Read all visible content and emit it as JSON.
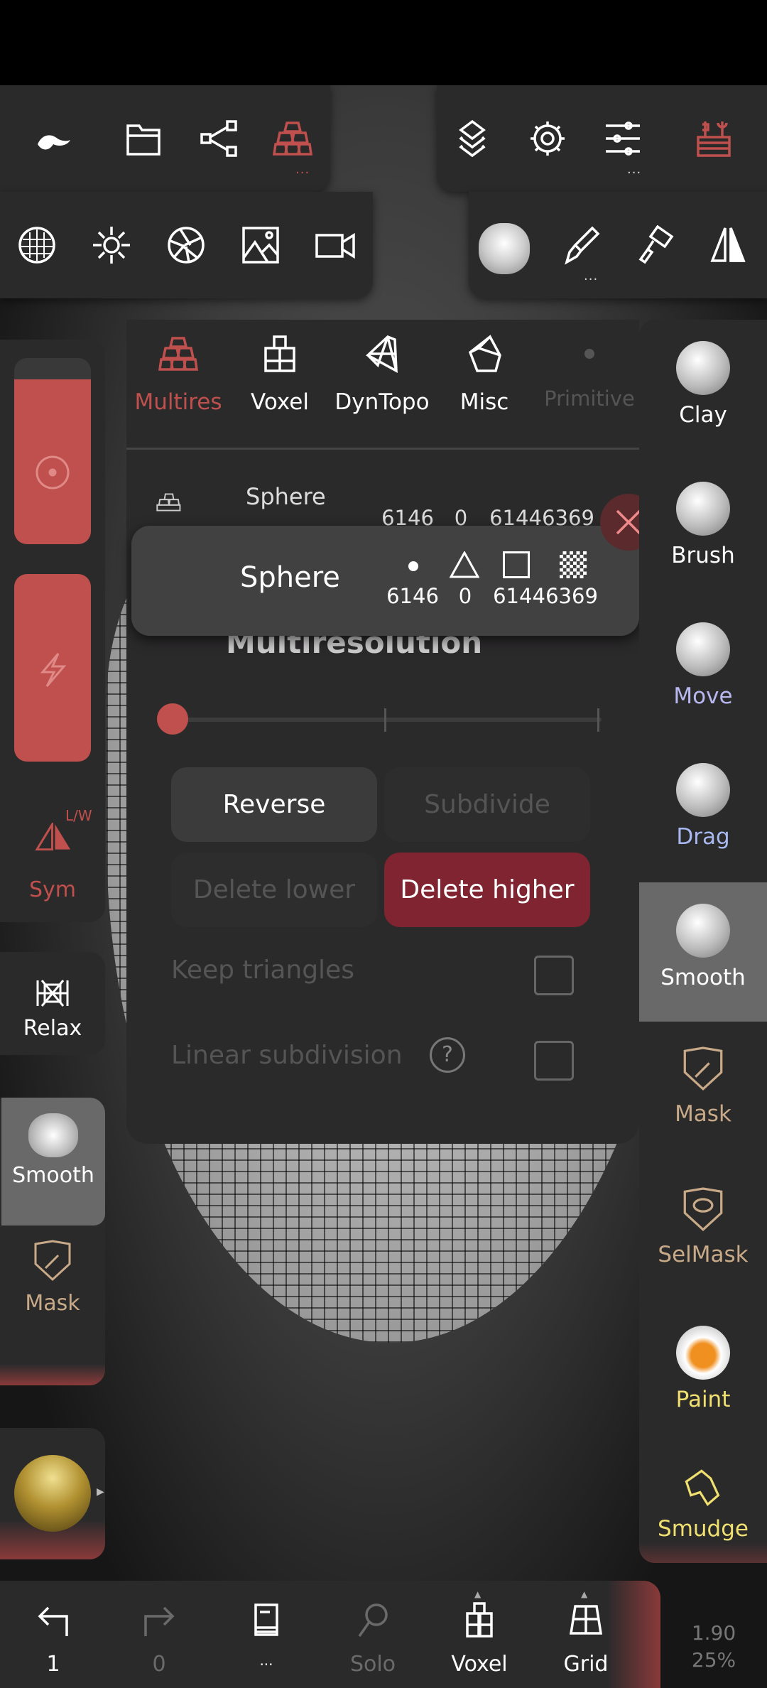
{
  "colors": {
    "accent": "#c0504d",
    "danger": "#7f2430",
    "panel": "#2b2a2b"
  },
  "top_toolbar": {
    "left": [
      {
        "icon": "nomad-logo-icon"
      },
      {
        "icon": "folder-icon"
      },
      {
        "icon": "share-icon"
      },
      {
        "icon": "multires-icon",
        "active": true,
        "more": "..."
      }
    ],
    "right": [
      {
        "icon": "layers-icon"
      },
      {
        "icon": "gear-icon"
      },
      {
        "icon": "sliders-icon",
        "more": "..."
      },
      {
        "icon": "toolbox-icon",
        "active": true
      }
    ]
  },
  "second_toolbar": {
    "left": [
      {
        "icon": "grid-sphere-icon"
      },
      {
        "icon": "sun-icon"
      },
      {
        "icon": "aperture-icon"
      },
      {
        "icon": "image-icon"
      },
      {
        "icon": "video-camera-icon"
      }
    ],
    "right": [
      {
        "icon": "smooth-brush-icon"
      },
      {
        "icon": "paint-brush-icon",
        "more": "..."
      },
      {
        "icon": "paint-roller-icon"
      },
      {
        "icon": "symmetry-icon"
      }
    ]
  },
  "panel": {
    "tabs": [
      {
        "label": "Multires",
        "active": true
      },
      {
        "label": "Voxel"
      },
      {
        "label": "DynTopo"
      },
      {
        "label": "Misc"
      },
      {
        "label": "Primitive",
        "disabled": true
      }
    ],
    "mesh_row": {
      "name": "Sphere",
      "vertices": "6146",
      "triangles": "0",
      "quads": "6144",
      "uvs": "6369"
    },
    "popup": {
      "name": "Sphere",
      "vertices": "6146",
      "triangles": "0",
      "quads": "6144",
      "uvs": "6369"
    },
    "section_title": "Multiresolution",
    "slider": {
      "levels": 3,
      "current_level": 1
    },
    "buttons": {
      "reverse": "Reverse",
      "subdivide": "Subdivide",
      "delete_lower": "Delete lower",
      "delete_higher": "Delete higher"
    },
    "options": [
      {
        "label": "Keep triangles",
        "checked": false
      },
      {
        "label": "Linear subdivision",
        "help": "?",
        "checked": false
      }
    ]
  },
  "left_sidebar": {
    "sym_label": "Sym",
    "sym_mode": "L/W",
    "tools": [
      {
        "label": "Relax"
      },
      {
        "label": "Smooth",
        "selected": true
      },
      {
        "label": "Mask"
      }
    ]
  },
  "right_sidebar": {
    "tools": [
      {
        "label": "Clay",
        "color": "#ffffff"
      },
      {
        "label": "Brush",
        "color": "#ffffff"
      },
      {
        "label": "Move",
        "color": "#b8b8f0"
      },
      {
        "label": "Drag",
        "color": "#a8b8f0"
      },
      {
        "label": "Smooth",
        "color": "#ffffff",
        "selected": true
      },
      {
        "label": "Mask",
        "color": "#c8aa88"
      },
      {
        "label": "SelMask",
        "color": "#c8aa88"
      },
      {
        "label": "Paint",
        "color": "#f0e070"
      },
      {
        "label": "Smudge",
        "color": "#f0e070"
      }
    ]
  },
  "bottom_bar": {
    "undo": "1",
    "redo": "0",
    "wiki": "...",
    "solo": "Solo",
    "voxel": "Voxel",
    "grid": "Grid"
  },
  "stats": {
    "line1": "1.90",
    "line2": "25%"
  }
}
